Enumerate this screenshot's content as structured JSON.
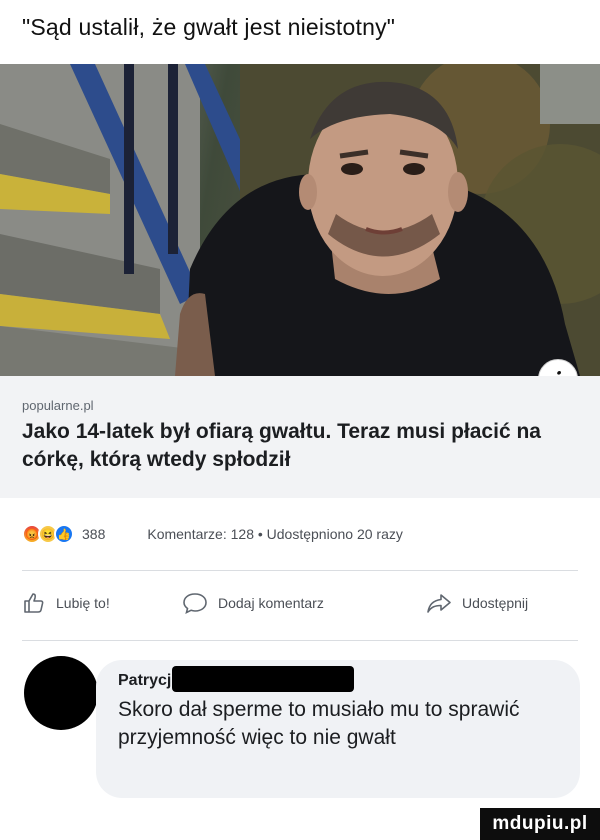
{
  "caption": "\"Sąd ustalił, że gwałt jest nieistotny\"",
  "article": {
    "photo_description_icon": "info-icon",
    "info_symbol": "i",
    "domain": "popularne.pl",
    "headline": "Jako 14-latek był ofiarą gwałtu. Teraz musi płacić na córkę, którą wtedy spłodził"
  },
  "stats": {
    "reaction_icons": [
      "angry-icon",
      "haha-icon",
      "like-icon"
    ],
    "reaction_count": "388",
    "comments_shares": "Komentarze: 128 • Udostępniono 20 razy"
  },
  "actions": {
    "like_label": "Lubię to!",
    "comment_label": "Dodaj komentarz",
    "share_label": "Udostępnij"
  },
  "comment": {
    "author": "Patrycj",
    "text": "Skoro dał sperme to musiało mu to sprawić przyjemność więc to nie gwałt"
  },
  "watermark": "mdupiu.pl",
  "colors": {
    "accent": "#1877f2",
    "link_box": "#f2f3f5",
    "comment_bubble": "#f0f2f5"
  }
}
